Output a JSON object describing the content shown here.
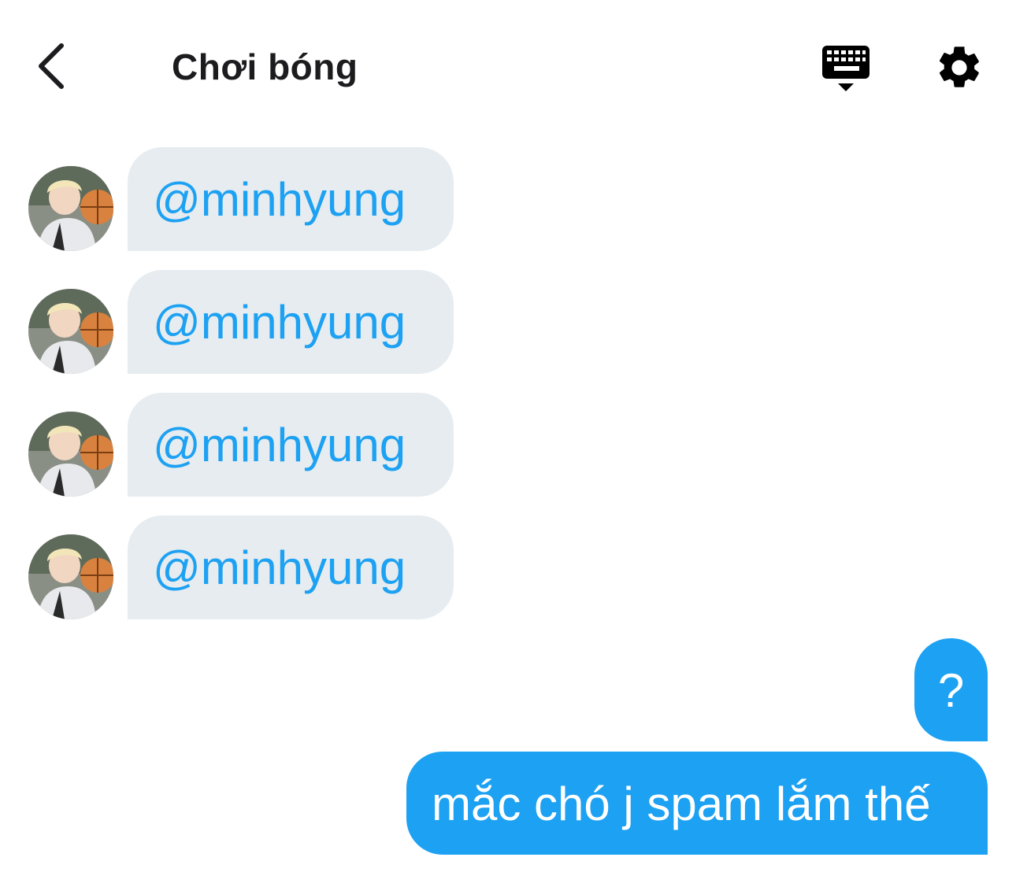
{
  "header": {
    "title": "Chơi bóng",
    "back_icon": "chevron-left-icon",
    "keyboard_icon": "keyboard-icon",
    "settings_icon": "gear-icon"
  },
  "messages_incoming": [
    {
      "text": "@minhyung"
    },
    {
      "text": "@minhyung"
    },
    {
      "text": "@minhyung"
    },
    {
      "text": "@minhyung"
    }
  ],
  "messages_outgoing": [
    {
      "text": "?"
    },
    {
      "text": "mắc chó j spam lắm thế"
    }
  ],
  "colors": {
    "accent": "#1da1f2",
    "incoming_bubble": "#e6ecf0",
    "title": "#1c1c1e"
  }
}
